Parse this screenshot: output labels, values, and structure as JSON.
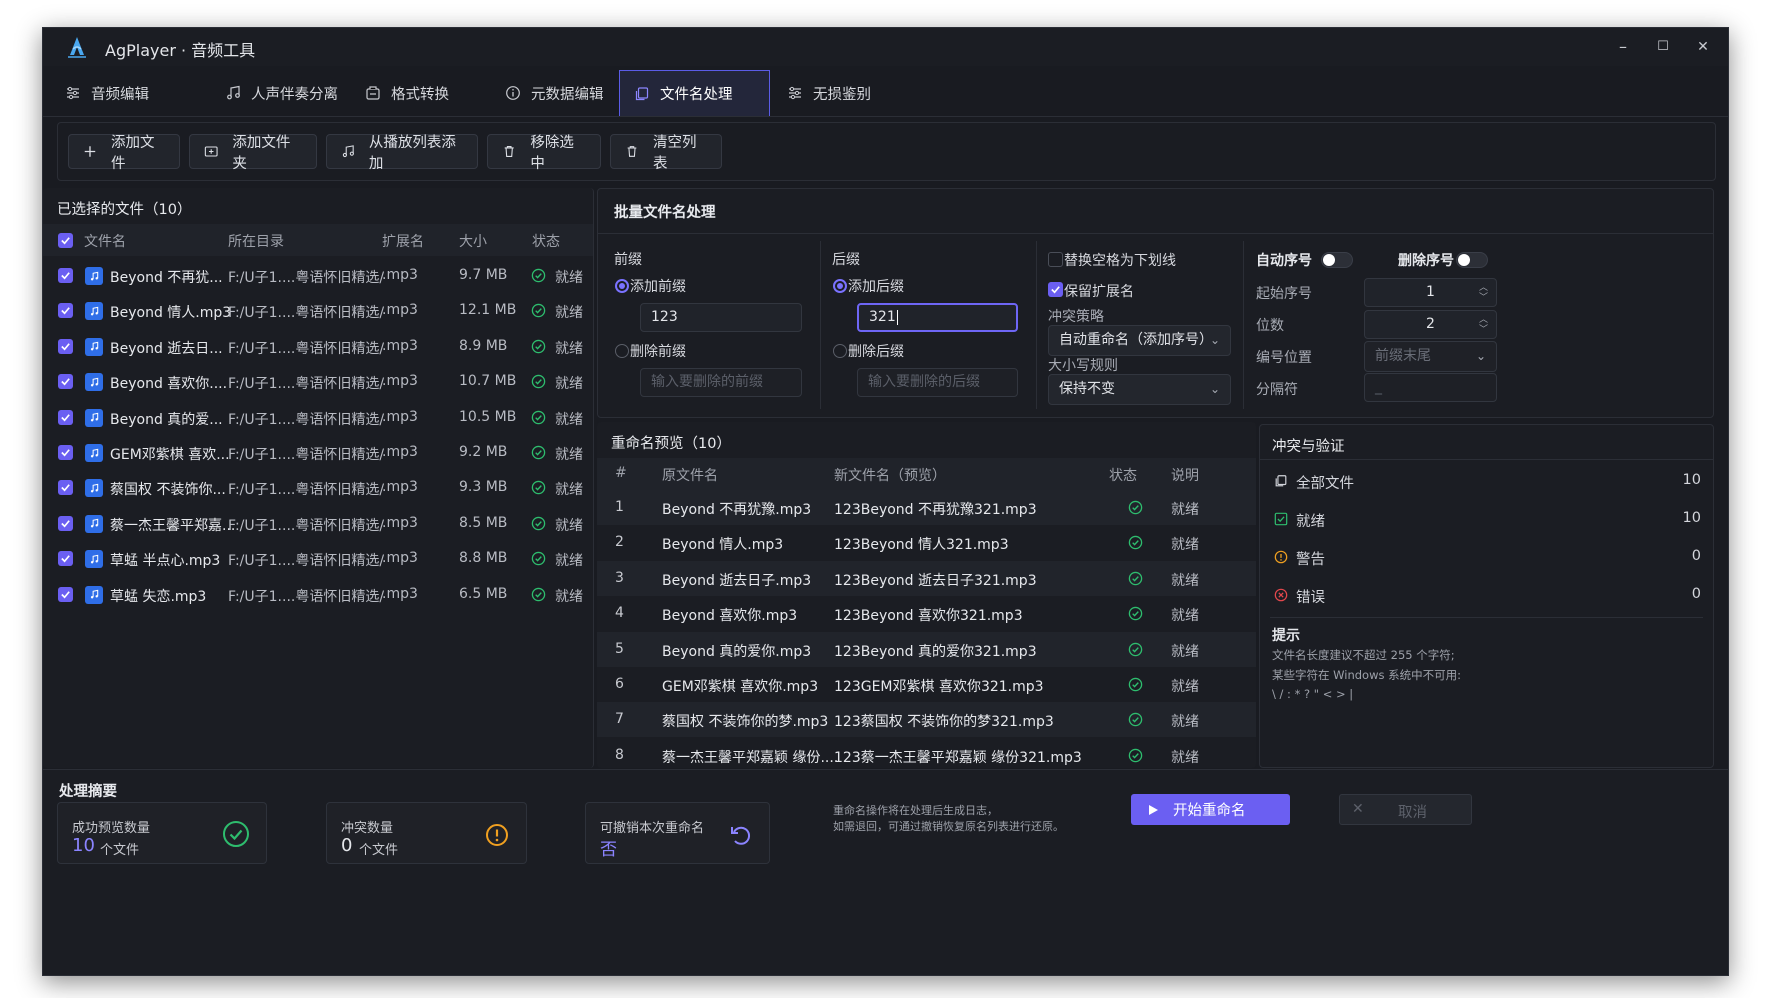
{
  "window": {
    "title": "AgPlayer · 音频工具",
    "minimize": "–",
    "maximize": "☐",
    "close": "✕"
  },
  "tabs": [
    {
      "label": "音频编辑",
      "icon": "sliders-icon"
    },
    {
      "label": "人声伴奏分离",
      "icon": "music-note-icon"
    },
    {
      "label": "格式转换",
      "icon": "convert-icon"
    },
    {
      "label": "元数据编辑",
      "icon": "info-icon"
    },
    {
      "label": "文件名处理",
      "icon": "copy-icon",
      "active": true
    },
    {
      "label": "无损鉴别",
      "icon": "sliders-icon"
    }
  ],
  "toolbar": {
    "add_file": "添加文件",
    "add_folder": "添加文件夹",
    "add_from_playlist": "从播放列表添加",
    "remove_selected": "移除选中",
    "clear_list": "清空列表"
  },
  "file_list": {
    "title": "已选择的文件（10）",
    "columns": [
      "文件名",
      "所在目录",
      "扩展名",
      "大小",
      "状态"
    ],
    "rows": [
      {
        "name": "Beyond  不再犹...",
        "dir": "F:/U子1....粤语怀旧精选/",
        "ext": ".mp3",
        "size": "9.7 MB",
        "status": "就绪"
      },
      {
        "name": "Beyond  情人.mp3",
        "dir": "F:/U子1....粤语怀旧精选/",
        "ext": ".mp3",
        "size": "12.1 MB",
        "status": "就绪"
      },
      {
        "name": "Beyond  逝去日...",
        "dir": "F:/U子1....粤语怀旧精选/",
        "ext": ".mp3",
        "size": "8.9 MB",
        "status": "就绪"
      },
      {
        "name": "Beyond  喜欢你....",
        "dir": "F:/U子1....粤语怀旧精选/",
        "ext": ".mp3",
        "size": "10.7 MB",
        "status": "就绪"
      },
      {
        "name": "Beyond  真的爱...",
        "dir": "F:/U子1....粤语怀旧精选/",
        "ext": ".mp3",
        "size": "10.5 MB",
        "status": "就绪"
      },
      {
        "name": "GEM邓紫棋  喜欢...",
        "dir": "F:/U子1....粤语怀旧精选/",
        "ext": ".mp3",
        "size": "9.2 MB",
        "status": "就绪"
      },
      {
        "name": "蔡国权  不装饰你...",
        "dir": "F:/U子1....粤语怀旧精选/",
        "ext": ".mp3",
        "size": "9.3 MB",
        "status": "就绪"
      },
      {
        "name": "蔡一杰王馨平郑嘉...",
        "dir": "F:/U子1....粤语怀旧精选/",
        "ext": ".mp3",
        "size": "8.5 MB",
        "status": "就绪"
      },
      {
        "name": "草蜢  半点心.mp3",
        "dir": "F:/U子1....粤语怀旧精选/",
        "ext": ".mp3",
        "size": "8.8 MB",
        "status": "就绪"
      },
      {
        "name": "草蜢  失恋.mp3",
        "dir": "F:/U子1....粤语怀旧精选/",
        "ext": ".mp3",
        "size": "6.5 MB",
        "status": "就绪"
      }
    ]
  },
  "batch": {
    "title": "批量文件名处理",
    "prefix": {
      "heading": "前缀",
      "add_label": "添加前缀",
      "add_value": "123",
      "remove_label": "删除前缀",
      "remove_placeholder": "输入要删除的前缀"
    },
    "suffix": {
      "heading": "后缀",
      "add_label": "添加后缀",
      "add_value": "321",
      "remove_label": "删除后缀",
      "remove_placeholder": "输入要删除的后缀"
    },
    "options": {
      "replace_space": "替换空格为下划线",
      "keep_ext": "保留扩展名",
      "conflict_label": "冲突策略",
      "conflict_value": "自动重命名（添加序号）",
      "case_label": "大小写规则",
      "case_value": "保持不变"
    },
    "numbering": {
      "auto_label": "自动序号",
      "delete_label": "删除序号",
      "start_label": "起始序号",
      "start_value": "1",
      "digits_label": "位数",
      "digits_value": "2",
      "position_label": "编号位置",
      "position_value": "前缀末尾",
      "separator_label": "分隔符",
      "separator_value": "_"
    }
  },
  "preview": {
    "title": "重命名预览（10）",
    "columns": [
      "#",
      "原文件名",
      "新文件名（预览）",
      "状态",
      "说明"
    ],
    "rows": [
      {
        "n": "1",
        "orig": "Beyond  不再犹豫.mp3",
        "new": "123Beyond  不再犹豫321.mp3",
        "note": "就绪"
      },
      {
        "n": "2",
        "orig": "Beyond  情人.mp3",
        "new": "123Beyond  情人321.mp3",
        "note": "就绪"
      },
      {
        "n": "3",
        "orig": "Beyond  逝去日子.mp3",
        "new": "123Beyond  逝去日子321.mp3",
        "note": "就绪"
      },
      {
        "n": "4",
        "orig": "Beyond  喜欢你.mp3",
        "new": "123Beyond  喜欢你321.mp3",
        "note": "就绪"
      },
      {
        "n": "5",
        "orig": "Beyond  真的爱你.mp3",
        "new": "123Beyond  真的爱你321.mp3",
        "note": "就绪"
      },
      {
        "n": "6",
        "orig": "GEM邓紫棋  喜欢你.mp3",
        "new": "123GEM邓紫棋  喜欢你321.mp3",
        "note": "就绪"
      },
      {
        "n": "7",
        "orig": "蔡国权  不装饰你的梦.mp3",
        "new": "123蔡国权  不装饰你的梦321.mp3",
        "note": "就绪"
      },
      {
        "n": "8",
        "orig": "蔡一杰王馨平郑嘉颖  缘份....",
        "new": "123蔡一杰王馨平郑嘉颖  缘份321.mp3",
        "note": "就绪"
      }
    ]
  },
  "validation": {
    "title": "冲突与验证",
    "all_label": "全部文件",
    "all_value": "10",
    "ready_label": "就绪",
    "ready_value": "10",
    "warn_label": "警告",
    "warn_value": "0",
    "error_label": "错误",
    "error_value": "0",
    "tips_title": "提示",
    "tips_line1": "文件名长度建议不超过 255 个字符;",
    "tips_line2": "某些字符在 Windows 系统中不可用:",
    "tips_line3": "\\ / : * ? \" < > |"
  },
  "summary": {
    "title": "处理摘要",
    "success_label": "成功预览数量",
    "success_value": "10",
    "success_unit": "个文件",
    "conflict_label": "冲突数量",
    "conflict_value": "0",
    "conflict_unit": "个文件",
    "undo_label": "可撤销本次重命名",
    "undo_value": "否",
    "info_line1": "重命名操作将在处理后生成日志，",
    "info_line2": "如需退回，可通过撤销恢复原名列表进行还原。",
    "start_button": "开始重命名",
    "cancel_button": "取消"
  },
  "colors": {
    "accent": "#6b5ff2",
    "success": "#2ebd6e",
    "warning": "#f0a020",
    "error": "#e5484d",
    "file_icon": "#2f6ee8"
  }
}
